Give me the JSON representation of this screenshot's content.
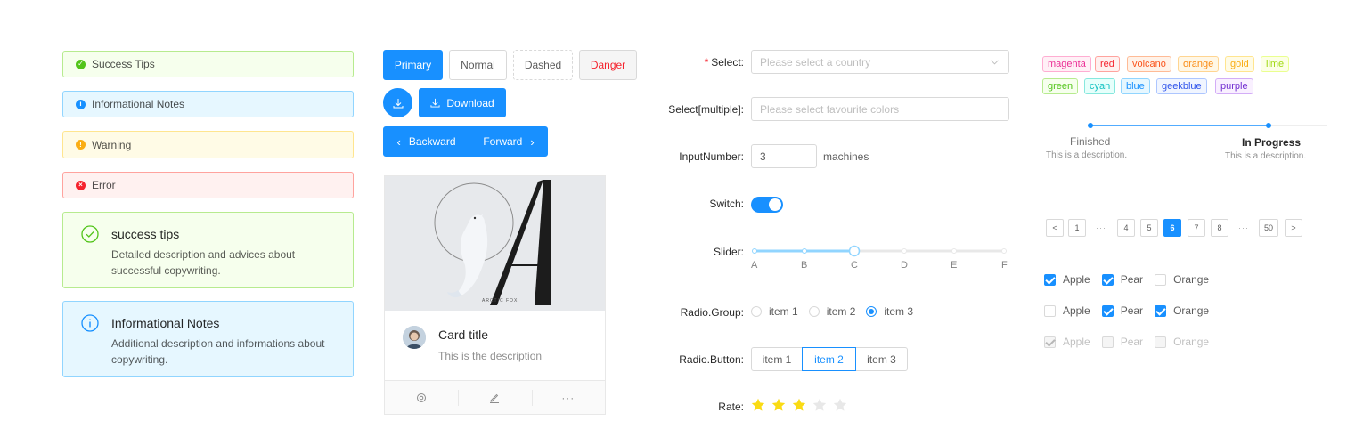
{
  "alerts": {
    "success": "Success Tips",
    "info": "Informational Notes",
    "warning": "Warning",
    "error": "Error",
    "success_big": {
      "message": "success tips",
      "description": "Detailed description and advices about successful copywriting."
    },
    "info_big": {
      "message": "Informational Notes",
      "description": "Additional description and informations about copywriting."
    }
  },
  "buttons": {
    "primary": "Primary",
    "normal": "Normal",
    "dashed": "Dashed",
    "danger": "Danger",
    "download": "Download",
    "backward": "Backward",
    "forward": "Forward"
  },
  "card": {
    "cover_caption": "ARCTIC FOX",
    "title": "Card title",
    "description": "This is the description",
    "actions": [
      "setting-icon",
      "edit-icon",
      "ellipsis-icon"
    ]
  },
  "form": {
    "select_label": "Select",
    "select_placeholder": "Please select a country",
    "select_multiple_label": "Select[multiple]",
    "select_multiple_placeholder": "Please select favourite colors",
    "input_number_label": "InputNumber",
    "input_number_value": "3",
    "input_number_suffix": "machines",
    "switch_label": "Switch",
    "switch_on": true,
    "slider_label": "Slider",
    "slider_marks": [
      "A",
      "B",
      "C",
      "D",
      "E",
      "F"
    ],
    "slider_value_index": 2,
    "radio_group_label": "Radio.Group",
    "radio_items": [
      "item 1",
      "item 2",
      "item 3"
    ],
    "radio_selected": "item 3",
    "radio_button_label": "Radio.Button",
    "radio_buttons": [
      "item 1",
      "item 2",
      "item 3"
    ],
    "radio_button_selected": "item 2",
    "rate_label": "Rate",
    "rate_value": 3,
    "rate_max": 5
  },
  "tags": [
    {
      "label": "magenta",
      "color": "#eb2f96",
      "bg": "#fff0f6",
      "border": "#ffadd2"
    },
    {
      "label": "red",
      "color": "#f5222d",
      "bg": "#fff1f0",
      "border": "#ffa39e"
    },
    {
      "label": "volcano",
      "color": "#fa541c",
      "bg": "#fff2e8",
      "border": "#ffbb96"
    },
    {
      "label": "orange",
      "color": "#fa8c16",
      "bg": "#fff7e6",
      "border": "#ffd591"
    },
    {
      "label": "gold",
      "color": "#faad14",
      "bg": "#fffbe6",
      "border": "#ffe58f"
    },
    {
      "label": "lime",
      "color": "#a0d911",
      "bg": "#fcffe6",
      "border": "#eaff8f"
    },
    {
      "label": "green",
      "color": "#52c41a",
      "bg": "#f6ffed",
      "border": "#b7eb8f"
    },
    {
      "label": "cyan",
      "color": "#13c2c2",
      "bg": "#e6fffb",
      "border": "#87e8de"
    },
    {
      "label": "blue",
      "color": "#1890ff",
      "bg": "#e6f7ff",
      "border": "#91d5ff"
    },
    {
      "label": "geekblue",
      "color": "#2f54eb",
      "bg": "#f0f5ff",
      "border": "#adc6ff"
    },
    {
      "label": "purple",
      "color": "#722ed1",
      "bg": "#f9f0ff",
      "border": "#d3adf7"
    }
  ],
  "steps": [
    {
      "title": "Finished",
      "description": "This is a description."
    },
    {
      "title": "In Progress",
      "description": "This is a description."
    }
  ],
  "pagination": {
    "prev": "<",
    "next": ">",
    "items": [
      "1",
      "···",
      "4",
      "5",
      "6",
      "7",
      "8",
      "···",
      "50"
    ],
    "current": "6"
  },
  "checkboxes": [
    [
      {
        "label": "Apple",
        "checked": true
      },
      {
        "label": "Pear",
        "checked": true
      },
      {
        "label": "Orange",
        "checked": false
      }
    ],
    [
      {
        "label": "Apple",
        "checked": false
      },
      {
        "label": "Pear",
        "checked": true
      },
      {
        "label": "Orange",
        "checked": true
      }
    ],
    [
      {
        "label": "Apple",
        "checked": true,
        "disabled": true
      },
      {
        "label": "Pear",
        "checked": false,
        "disabled": true
      },
      {
        "label": "Orange",
        "checked": false,
        "disabled": true
      }
    ]
  ],
  "colors": {
    "primary": "#1890ff",
    "danger": "#f5222d",
    "star": "#fadb14",
    "star_off": "#e8e8e8"
  }
}
